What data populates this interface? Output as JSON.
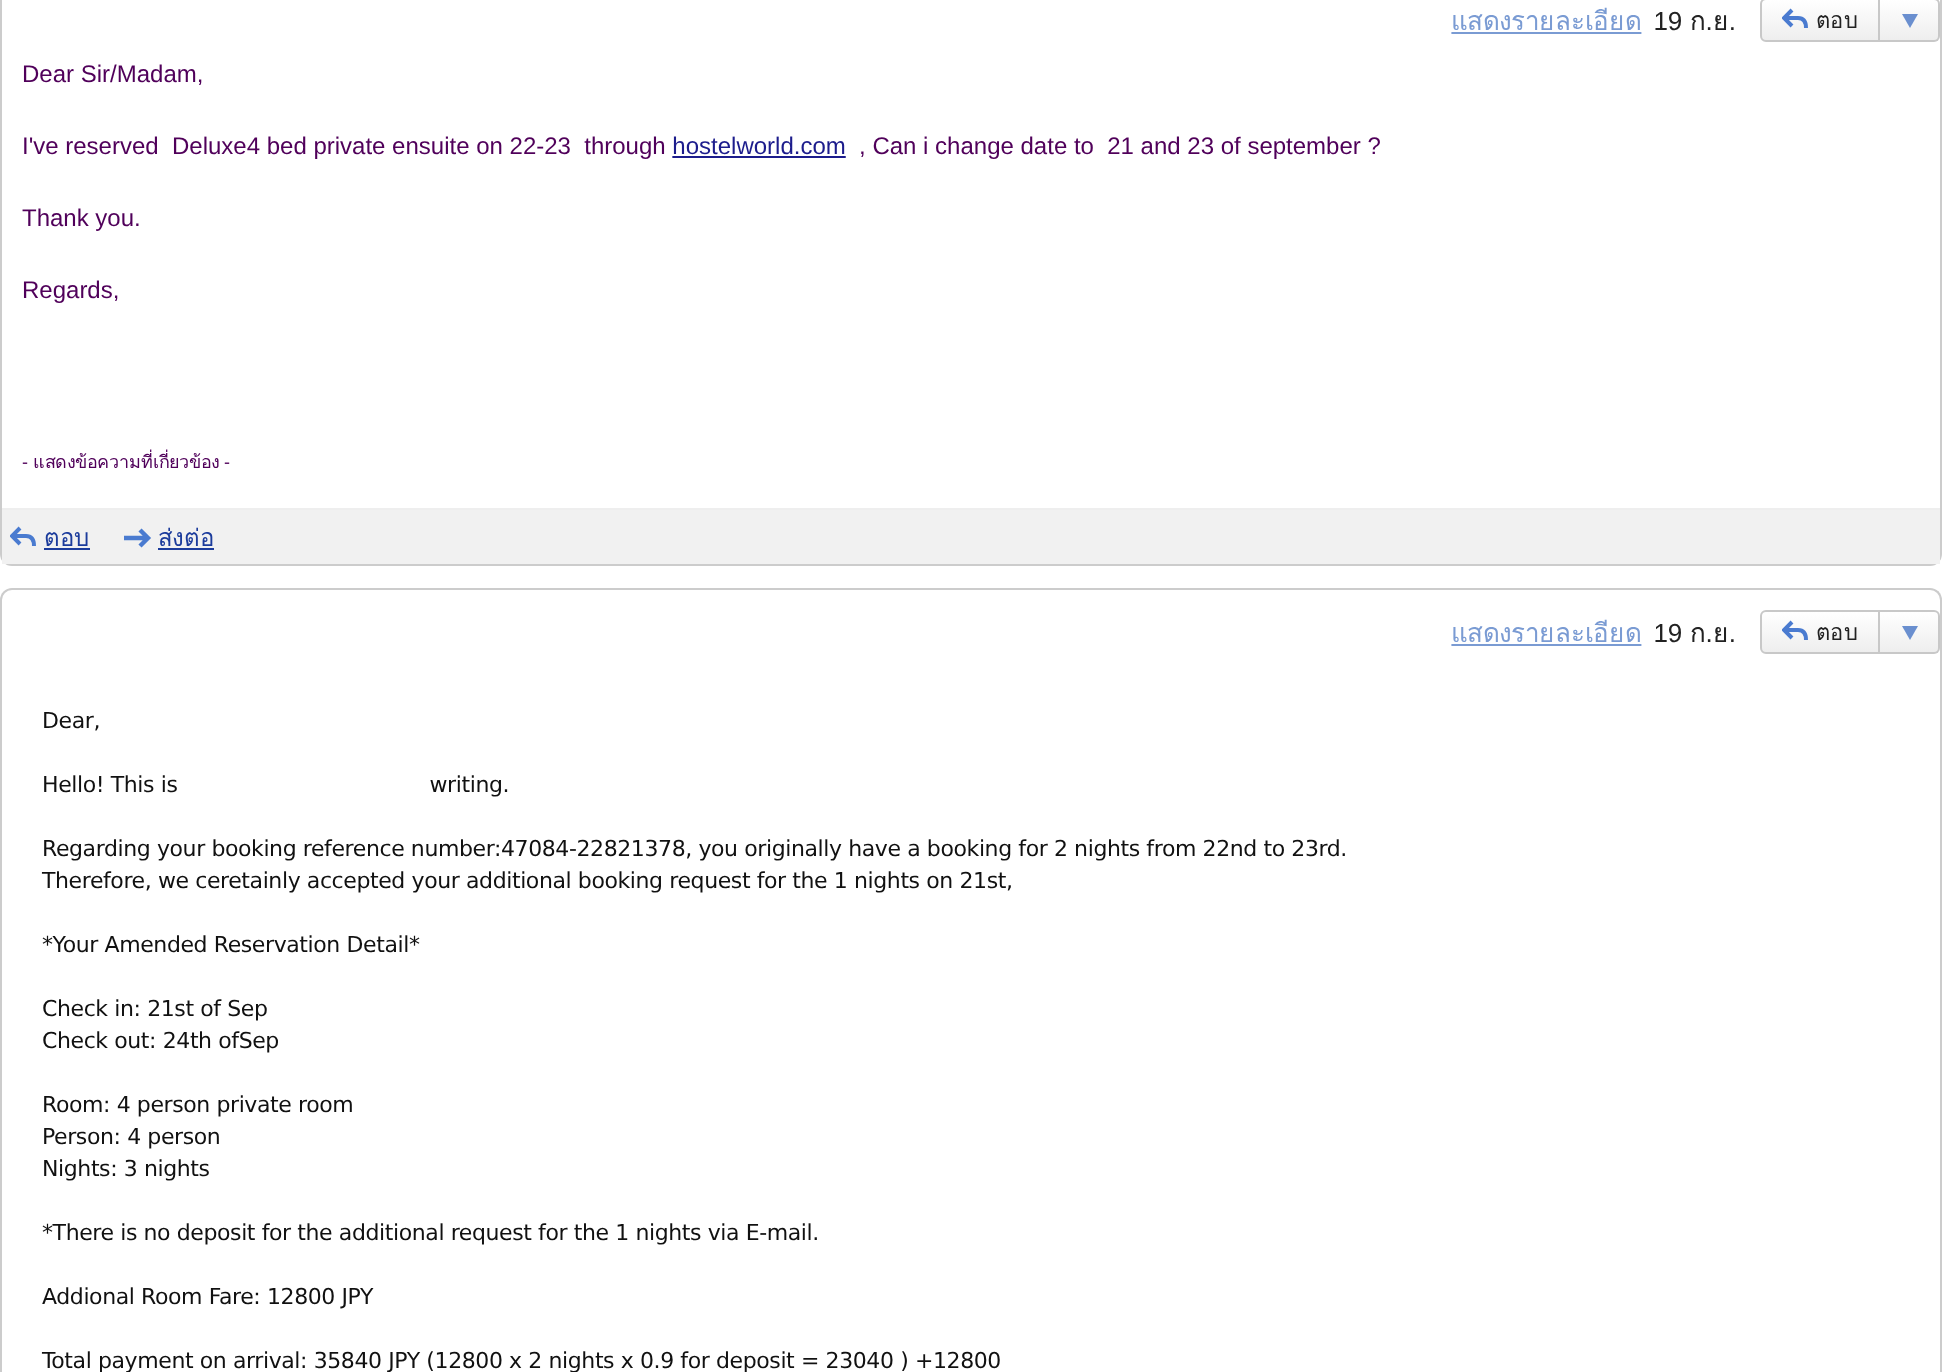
{
  "messages": [
    {
      "kind": "sent",
      "header": {
        "details_link": "แสดงรายละเอียด",
        "date": "19 ก.ย.",
        "reply_button": "ตอบ"
      },
      "paragraphs": [
        [
          [
            {
              "kind": "text",
              "text": "Dear Sir/Madam,"
            }
          ]
        ],
        [
          [
            {
              "kind": "text",
              "text": "I've reserved  Deluxe4 bed private ensuite on 22-23  through "
            },
            {
              "kind": "link",
              "text": "hostelworld.com"
            },
            {
              "kind": "text",
              "text": "  , Can i change date to  21 and 23 of september ?"
            }
          ]
        ],
        [
          [
            {
              "kind": "text",
              "text": "Thank you."
            }
          ]
        ],
        [
          [
            {
              "kind": "text",
              "text": "Regards,"
            }
          ]
        ]
      ],
      "related_link": "- แสดงข้อความที่เกี่ยวข้อง -",
      "footer": {
        "reply_link": "ตอบ",
        "forward_link": "ส่งต่อ"
      }
    },
    {
      "kind": "received",
      "header": {
        "details_link": "แสดงรายละเอียด",
        "date": "19 ก.ย.",
        "reply_button": "ตอบ"
      },
      "paragraphs": [
        [
          [
            {
              "kind": "text",
              "text": "Dear,"
            }
          ]
        ],
        [
          [
            {
              "kind": "text",
              "text": "Hello! This is"
            },
            {
              "kind": "redacted"
            },
            {
              "kind": "text",
              "text": "writing."
            }
          ]
        ],
        [
          [
            {
              "kind": "text",
              "text": "Regarding your booking reference number:47084-22821378, you originally have a booking for 2 nights from 22nd to 23rd."
            }
          ],
          [
            {
              "kind": "text",
              "text": "Therefore, we ceretainly accepted your additional booking request for the 1 nights on 21st,"
            }
          ]
        ],
        [
          [
            {
              "kind": "text",
              "text": "*Your Amended Reservation Detail*"
            }
          ]
        ],
        [
          [
            {
              "kind": "text",
              "text": "Check in: 21st of Sep"
            }
          ],
          [
            {
              "kind": "text",
              "text": "Check out: 24th ofSep"
            }
          ]
        ],
        [
          [
            {
              "kind": "text",
              "text": "Room: 4 person private room"
            }
          ],
          [
            {
              "kind": "text",
              "text": "Person: 4 person"
            }
          ],
          [
            {
              "kind": "text",
              "text": "Nights: 3 nights"
            }
          ]
        ],
        [
          [
            {
              "kind": "text",
              "text": "*There is no deposit for the additional request for the 1 nights via E-mail."
            }
          ]
        ],
        [
          [
            {
              "kind": "text",
              "text": "Addional Room Fare: 12800 JPY"
            }
          ]
        ],
        [
          [
            {
              "kind": "text",
              "text": "Total payment on arrival: 35840 JPY (12800 x 2 nights x 0.9 for deposit = 23040 ) +12800"
            }
          ]
        ]
      ]
    }
  ]
}
